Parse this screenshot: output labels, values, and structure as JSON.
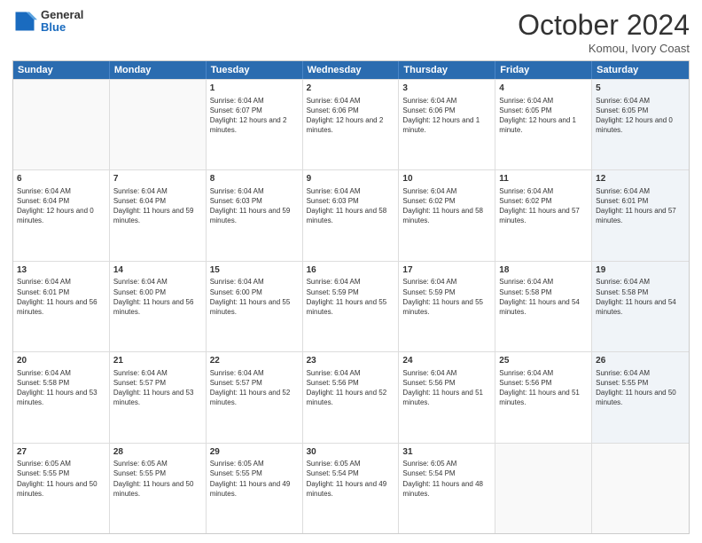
{
  "header": {
    "logo_general": "General",
    "logo_blue": "Blue",
    "month_title": "October 2024",
    "location": "Komou, Ivory Coast"
  },
  "days_of_week": [
    "Sunday",
    "Monday",
    "Tuesday",
    "Wednesday",
    "Thursday",
    "Friday",
    "Saturday"
  ],
  "weeks": [
    [
      {
        "day": "",
        "empty": true,
        "shaded": false
      },
      {
        "day": "",
        "empty": true,
        "shaded": false
      },
      {
        "day": "1",
        "empty": false,
        "shaded": false,
        "sunrise": "6:04 AM",
        "sunset": "6:07 PM",
        "daylight": "12 hours and 2 minutes."
      },
      {
        "day": "2",
        "empty": false,
        "shaded": false,
        "sunrise": "6:04 AM",
        "sunset": "6:06 PM",
        "daylight": "12 hours and 2 minutes."
      },
      {
        "day": "3",
        "empty": false,
        "shaded": false,
        "sunrise": "6:04 AM",
        "sunset": "6:06 PM",
        "daylight": "12 hours and 1 minute."
      },
      {
        "day": "4",
        "empty": false,
        "shaded": false,
        "sunrise": "6:04 AM",
        "sunset": "6:05 PM",
        "daylight": "12 hours and 1 minute."
      },
      {
        "day": "5",
        "empty": false,
        "shaded": true,
        "sunrise": "6:04 AM",
        "sunset": "6:05 PM",
        "daylight": "12 hours and 0 minutes."
      }
    ],
    [
      {
        "day": "6",
        "empty": false,
        "shaded": false,
        "sunrise": "6:04 AM",
        "sunset": "6:04 PM",
        "daylight": "12 hours and 0 minutes."
      },
      {
        "day": "7",
        "empty": false,
        "shaded": false,
        "sunrise": "6:04 AM",
        "sunset": "6:04 PM",
        "daylight": "11 hours and 59 minutes."
      },
      {
        "day": "8",
        "empty": false,
        "shaded": false,
        "sunrise": "6:04 AM",
        "sunset": "6:03 PM",
        "daylight": "11 hours and 59 minutes."
      },
      {
        "day": "9",
        "empty": false,
        "shaded": false,
        "sunrise": "6:04 AM",
        "sunset": "6:03 PM",
        "daylight": "11 hours and 58 minutes."
      },
      {
        "day": "10",
        "empty": false,
        "shaded": false,
        "sunrise": "6:04 AM",
        "sunset": "6:02 PM",
        "daylight": "11 hours and 58 minutes."
      },
      {
        "day": "11",
        "empty": false,
        "shaded": false,
        "sunrise": "6:04 AM",
        "sunset": "6:02 PM",
        "daylight": "11 hours and 57 minutes."
      },
      {
        "day": "12",
        "empty": false,
        "shaded": true,
        "sunrise": "6:04 AM",
        "sunset": "6:01 PM",
        "daylight": "11 hours and 57 minutes."
      }
    ],
    [
      {
        "day": "13",
        "empty": false,
        "shaded": false,
        "sunrise": "6:04 AM",
        "sunset": "6:01 PM",
        "daylight": "11 hours and 56 minutes."
      },
      {
        "day": "14",
        "empty": false,
        "shaded": false,
        "sunrise": "6:04 AM",
        "sunset": "6:00 PM",
        "daylight": "11 hours and 56 minutes."
      },
      {
        "day": "15",
        "empty": false,
        "shaded": false,
        "sunrise": "6:04 AM",
        "sunset": "6:00 PM",
        "daylight": "11 hours and 55 minutes."
      },
      {
        "day": "16",
        "empty": false,
        "shaded": false,
        "sunrise": "6:04 AM",
        "sunset": "5:59 PM",
        "daylight": "11 hours and 55 minutes."
      },
      {
        "day": "17",
        "empty": false,
        "shaded": false,
        "sunrise": "6:04 AM",
        "sunset": "5:59 PM",
        "daylight": "11 hours and 55 minutes."
      },
      {
        "day": "18",
        "empty": false,
        "shaded": false,
        "sunrise": "6:04 AM",
        "sunset": "5:58 PM",
        "daylight": "11 hours and 54 minutes."
      },
      {
        "day": "19",
        "empty": false,
        "shaded": true,
        "sunrise": "6:04 AM",
        "sunset": "5:58 PM",
        "daylight": "11 hours and 54 minutes."
      }
    ],
    [
      {
        "day": "20",
        "empty": false,
        "shaded": false,
        "sunrise": "6:04 AM",
        "sunset": "5:58 PM",
        "daylight": "11 hours and 53 minutes."
      },
      {
        "day": "21",
        "empty": false,
        "shaded": false,
        "sunrise": "6:04 AM",
        "sunset": "5:57 PM",
        "daylight": "11 hours and 53 minutes."
      },
      {
        "day": "22",
        "empty": false,
        "shaded": false,
        "sunrise": "6:04 AM",
        "sunset": "5:57 PM",
        "daylight": "11 hours and 52 minutes."
      },
      {
        "day": "23",
        "empty": false,
        "shaded": false,
        "sunrise": "6:04 AM",
        "sunset": "5:56 PM",
        "daylight": "11 hours and 52 minutes."
      },
      {
        "day": "24",
        "empty": false,
        "shaded": false,
        "sunrise": "6:04 AM",
        "sunset": "5:56 PM",
        "daylight": "11 hours and 51 minutes."
      },
      {
        "day": "25",
        "empty": false,
        "shaded": false,
        "sunrise": "6:04 AM",
        "sunset": "5:56 PM",
        "daylight": "11 hours and 51 minutes."
      },
      {
        "day": "26",
        "empty": false,
        "shaded": true,
        "sunrise": "6:04 AM",
        "sunset": "5:55 PM",
        "daylight": "11 hours and 50 minutes."
      }
    ],
    [
      {
        "day": "27",
        "empty": false,
        "shaded": false,
        "sunrise": "6:05 AM",
        "sunset": "5:55 PM",
        "daylight": "11 hours and 50 minutes."
      },
      {
        "day": "28",
        "empty": false,
        "shaded": false,
        "sunrise": "6:05 AM",
        "sunset": "5:55 PM",
        "daylight": "11 hours and 50 minutes."
      },
      {
        "day": "29",
        "empty": false,
        "shaded": false,
        "sunrise": "6:05 AM",
        "sunset": "5:55 PM",
        "daylight": "11 hours and 49 minutes."
      },
      {
        "day": "30",
        "empty": false,
        "shaded": false,
        "sunrise": "6:05 AM",
        "sunset": "5:54 PM",
        "daylight": "11 hours and 49 minutes."
      },
      {
        "day": "31",
        "empty": false,
        "shaded": false,
        "sunrise": "6:05 AM",
        "sunset": "5:54 PM",
        "daylight": "11 hours and 48 minutes."
      },
      {
        "day": "",
        "empty": true,
        "shaded": false
      },
      {
        "day": "",
        "empty": true,
        "shaded": false
      }
    ]
  ]
}
